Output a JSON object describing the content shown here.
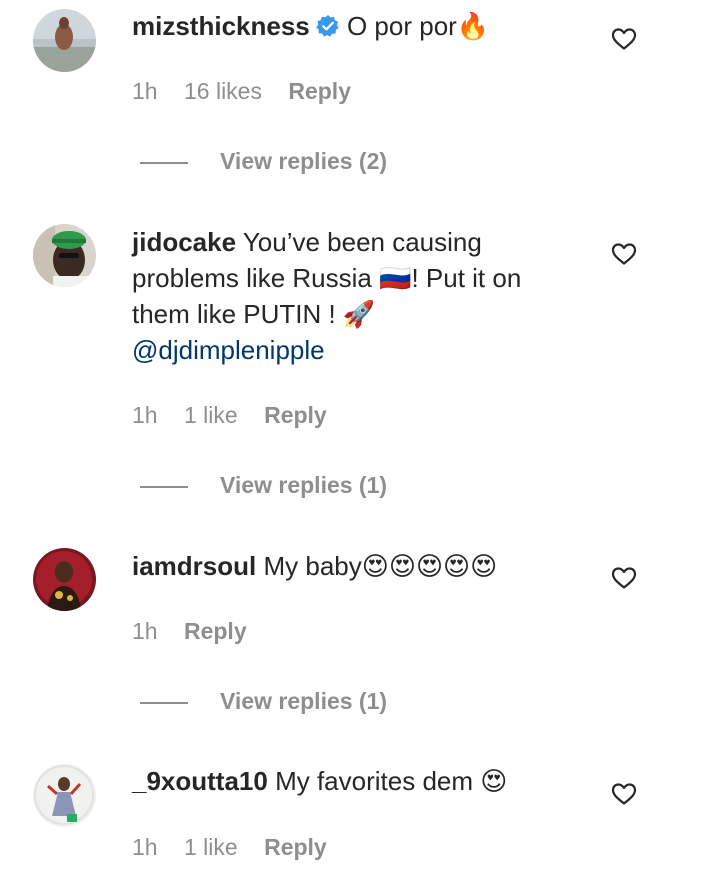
{
  "comments": [
    {
      "username": "mizsthickness",
      "verified": true,
      "text": "O por por🔥",
      "mention": "",
      "time": "1h",
      "likes": "16 likes",
      "reply_label": "Reply",
      "view_replies": "View replies (2)"
    },
    {
      "username": "jidocake",
      "verified": false,
      "text": "You’ve been causing problems like Russia 🇷🇺! Put it on them like PUTIN ! 🚀",
      "mention": "@djdimplenipple",
      "time": "1h",
      "likes": "1 like",
      "reply_label": "Reply",
      "view_replies": "View replies (1)"
    },
    {
      "username": "iamdrsoul",
      "verified": false,
      "text": "My baby😍😍😍😍😍",
      "mention": "",
      "time": "1h",
      "likes": "",
      "reply_label": "Reply",
      "view_replies": "View replies (1)"
    },
    {
      "username": "_9xoutta10",
      "verified": false,
      "text": "My favorites dem 😍",
      "mention": "",
      "time": "1h",
      "likes": "1 like",
      "reply_label": "Reply",
      "view_replies": ""
    }
  ],
  "icons": {
    "heart": "heart-outline-icon",
    "verified": "verified-badge-icon"
  },
  "colors": {
    "text": "#262626",
    "muted": "#8e8e8e",
    "mention": "#00376b",
    "verified": "#3897f0"
  }
}
